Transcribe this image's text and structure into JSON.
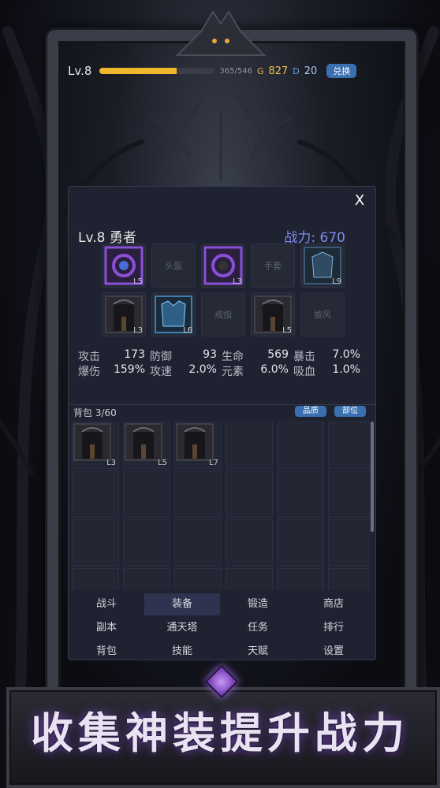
{
  "topbar": {
    "level": "Lv.8",
    "xp_text": "365/546",
    "xp_fraction": 0.668,
    "gold_symbol": "G",
    "gold": "827",
    "diamond_symbol": "D",
    "diamond": "20",
    "exchange_label": "兑换"
  },
  "panel": {
    "close_label": "X",
    "hero_title": "Lv.8 勇者",
    "power_label": "战力: 670",
    "slots": [
      {
        "label": "",
        "level": "L5",
        "icon": "amulet-icon",
        "color": "#8a4fd8"
      },
      {
        "label": "头盔",
        "level": "",
        "icon": "",
        "color": ""
      },
      {
        "label": "",
        "level": "L3",
        "icon": "ring-icon",
        "color": "#8a4fd8"
      },
      {
        "label": "手套",
        "level": "",
        "icon": "",
        "color": ""
      },
      {
        "label": "",
        "level": "L9",
        "icon": "armor-icon",
        "color": "#3a5a78"
      },
      {
        "label": "",
        "level": "L3",
        "icon": "gate-icon",
        "color": "#4a4a52"
      },
      {
        "label": "",
        "level": "L6",
        "icon": "chest-armor-icon",
        "color": "#3f7fb0"
      },
      {
        "label": "戒指",
        "level": "",
        "icon": "",
        "color": ""
      },
      {
        "label": "",
        "level": "L5",
        "icon": "gate-icon",
        "color": "#4a4a52"
      },
      {
        "label": "披风",
        "level": "",
        "icon": "",
        "color": ""
      }
    ],
    "stats": [
      [
        {
          "k": "攻击",
          "v": "173"
        },
        {
          "k": "防御",
          "v": "93"
        },
        {
          "k": "生命",
          "v": "569"
        },
        {
          "k": "暴击",
          "v": "7.0%"
        }
      ],
      [
        {
          "k": "爆伤",
          "v": "159%"
        },
        {
          "k": "攻速",
          "v": "2.0%"
        },
        {
          "k": "元素",
          "v": "6.0%"
        },
        {
          "k": "吸血",
          "v": "1.0%"
        }
      ]
    ],
    "bag_title": "背包 3/60",
    "sort_quality": "品质",
    "sort_slot": "部位",
    "bag_items": [
      {
        "level": "L3",
        "icon": "gate-icon"
      },
      {
        "level": "L5",
        "icon": "gate-icon"
      },
      {
        "level": "L7",
        "icon": "gate-icon"
      }
    ],
    "menu": [
      [
        "战斗",
        "装备",
        "锻造",
        "商店"
      ],
      [
        "副本",
        "通天塔",
        "任务",
        "排行"
      ],
      [
        "背包",
        "技能",
        "天赋",
        "设置"
      ]
    ],
    "active_menu": "装备"
  },
  "banner": {
    "text": "收集神装提升战力"
  },
  "colors": {
    "accent_blue": "#3a6fb0",
    "power_purple": "#7d8cf0",
    "gold": "#e9c34f",
    "xp_bar": "#f0b62c"
  }
}
